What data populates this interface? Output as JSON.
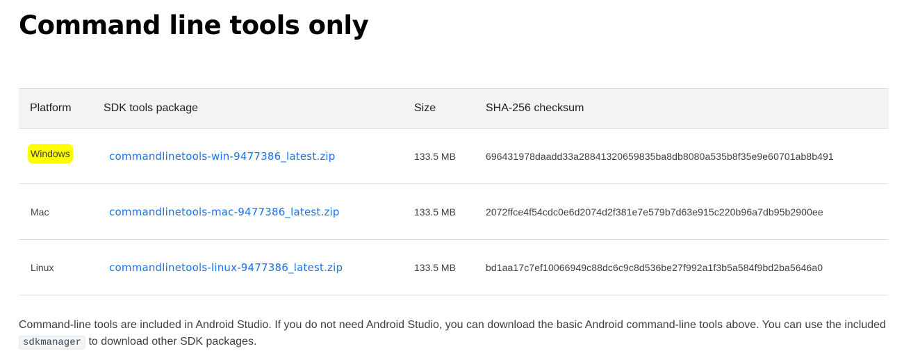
{
  "page": {
    "title": "Command line tools only"
  },
  "table": {
    "headers": {
      "platform": "Platform",
      "package": "SDK tools package",
      "size": "Size",
      "checksum": "SHA-256 checksum"
    },
    "rows": [
      {
        "platform": "Windows",
        "package": "commandlinetools-win-9477386_latest.zip",
        "size": "133.5 MB",
        "checksum": "696431978daadd33a28841320659835ba8db8080a535b8f35e9e60701ab8b491",
        "highlighted": true
      },
      {
        "platform": "Mac",
        "package": "commandlinetools-mac-9477386_latest.zip",
        "size": "133.5 MB",
        "checksum": "2072ffce4f54cdc0e6d2074d2f381e7e579b7d63e915c220b96a7db95b2900ee",
        "highlighted": false
      },
      {
        "platform": "Linux",
        "package": "commandlinetools-linux-9477386_latest.zip",
        "size": "133.5 MB",
        "checksum": "bd1aa17c7ef10066949c88dc6c9c8d536be27f992a1f3b5a584f9bd2ba5646a0",
        "highlighted": false
      }
    ]
  },
  "note": {
    "text_before": "Command-line tools are included in Android Studio. If you do not need Android Studio, you can download the basic Android command-line tools above. You can use the included ",
    "code": "sdkmanager",
    "text_after": " to download other SDK packages."
  },
  "colors": {
    "link": "#1a73e8",
    "highlight": "#ffff00",
    "header_bg": "#f1f3f4"
  }
}
